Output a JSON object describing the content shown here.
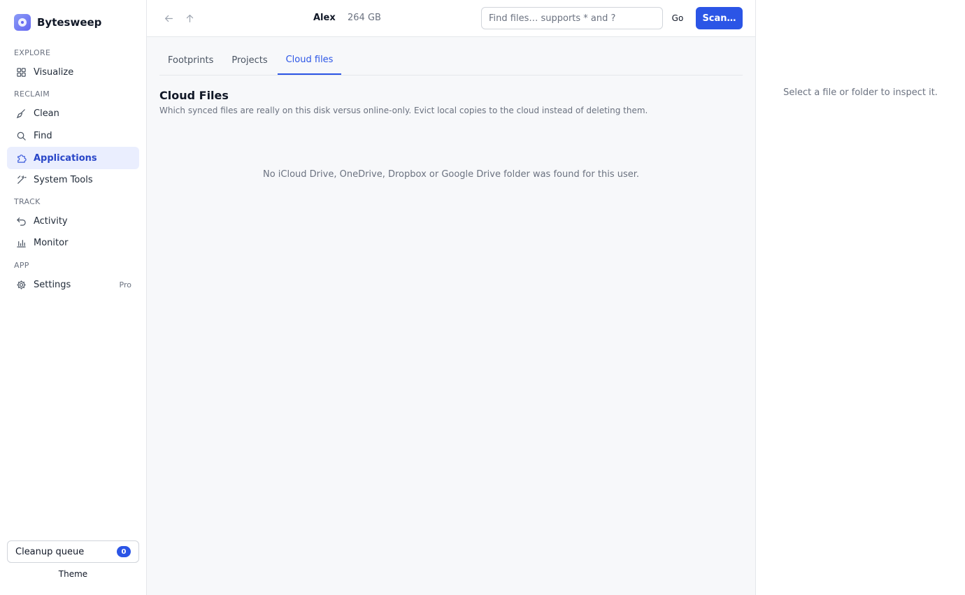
{
  "app": {
    "name": "Bytesweep"
  },
  "sidebar": {
    "sections": [
      {
        "label": "EXPLORE"
      },
      {
        "label": "RECLAIM"
      },
      {
        "label": "TRACK"
      },
      {
        "label": "APP"
      }
    ],
    "items": [
      {
        "label": "Visualize",
        "icon": "grid-icon"
      },
      {
        "label": "Clean",
        "icon": "broom-icon"
      },
      {
        "label": "Find",
        "icon": "search-icon"
      },
      {
        "label": "Applications",
        "icon": "puzzle-icon",
        "active": true
      },
      {
        "label": "System Tools",
        "icon": "wand-icon"
      },
      {
        "label": "Activity",
        "icon": "undo-icon"
      },
      {
        "label": "Monitor",
        "icon": "bar-chart-icon"
      },
      {
        "label": "Settings",
        "icon": "gear-icon",
        "badge": "Pro"
      }
    ],
    "queue": {
      "label": "Cleanup queue",
      "count": "0"
    },
    "theme_label": "Theme"
  },
  "toolbar": {
    "user": "Alex",
    "size": "264 GB",
    "search_placeholder": "Find files… supports * and ?",
    "search_value": "",
    "go_label": "Go",
    "scan_label": "Scan…"
  },
  "tabs": [
    {
      "label": "Footprints"
    },
    {
      "label": "Projects"
    },
    {
      "label": "Cloud files",
      "active": true
    }
  ],
  "content": {
    "title": "Cloud Files",
    "subtitle": "Which synced files are really on this disk versus online-only. Evict local copies to the cloud instead of deleting them.",
    "empty_message": "No iCloud Drive, OneDrive, Dropbox or Google Drive folder was found for this user."
  },
  "inspector": {
    "message": "Select a file or folder to inspect it."
  },
  "colors": {
    "accent": "#2b55e6",
    "active_bg": "#eaeefe",
    "muted_text": "#6b7280"
  }
}
